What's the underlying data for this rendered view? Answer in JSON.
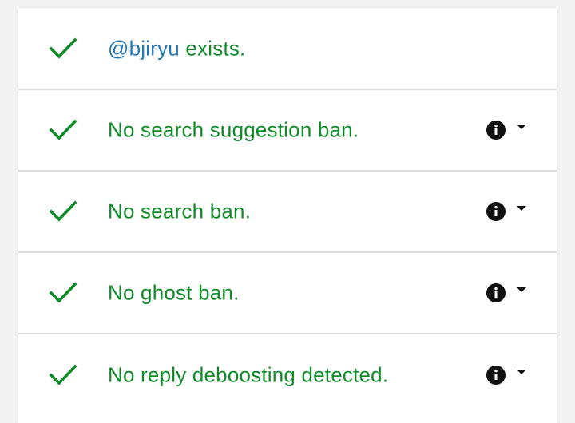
{
  "colors": {
    "success_green": "#118a2a",
    "handle_blue": "#2277bb",
    "icon_black": "#111111",
    "divider": "#dcdcdc"
  },
  "results": [
    {
      "status_icon": "check-icon",
      "handle": "@bjiryu",
      "label": " exists.",
      "has_info": false
    },
    {
      "status_icon": "check-icon",
      "label": "No search suggestion ban.",
      "has_info": true,
      "info_icon": "info-icon",
      "toggle_icon": "caret-down-icon"
    },
    {
      "status_icon": "check-icon",
      "label": "No search ban.",
      "has_info": true,
      "info_icon": "info-icon",
      "toggle_icon": "caret-down-icon"
    },
    {
      "status_icon": "check-icon",
      "label": "No ghost ban.",
      "has_info": true,
      "info_icon": "info-icon",
      "toggle_icon": "caret-down-icon"
    },
    {
      "status_icon": "check-icon",
      "label": "No reply deboosting detected.",
      "has_info": true,
      "info_icon": "info-icon",
      "toggle_icon": "caret-down-icon"
    }
  ]
}
